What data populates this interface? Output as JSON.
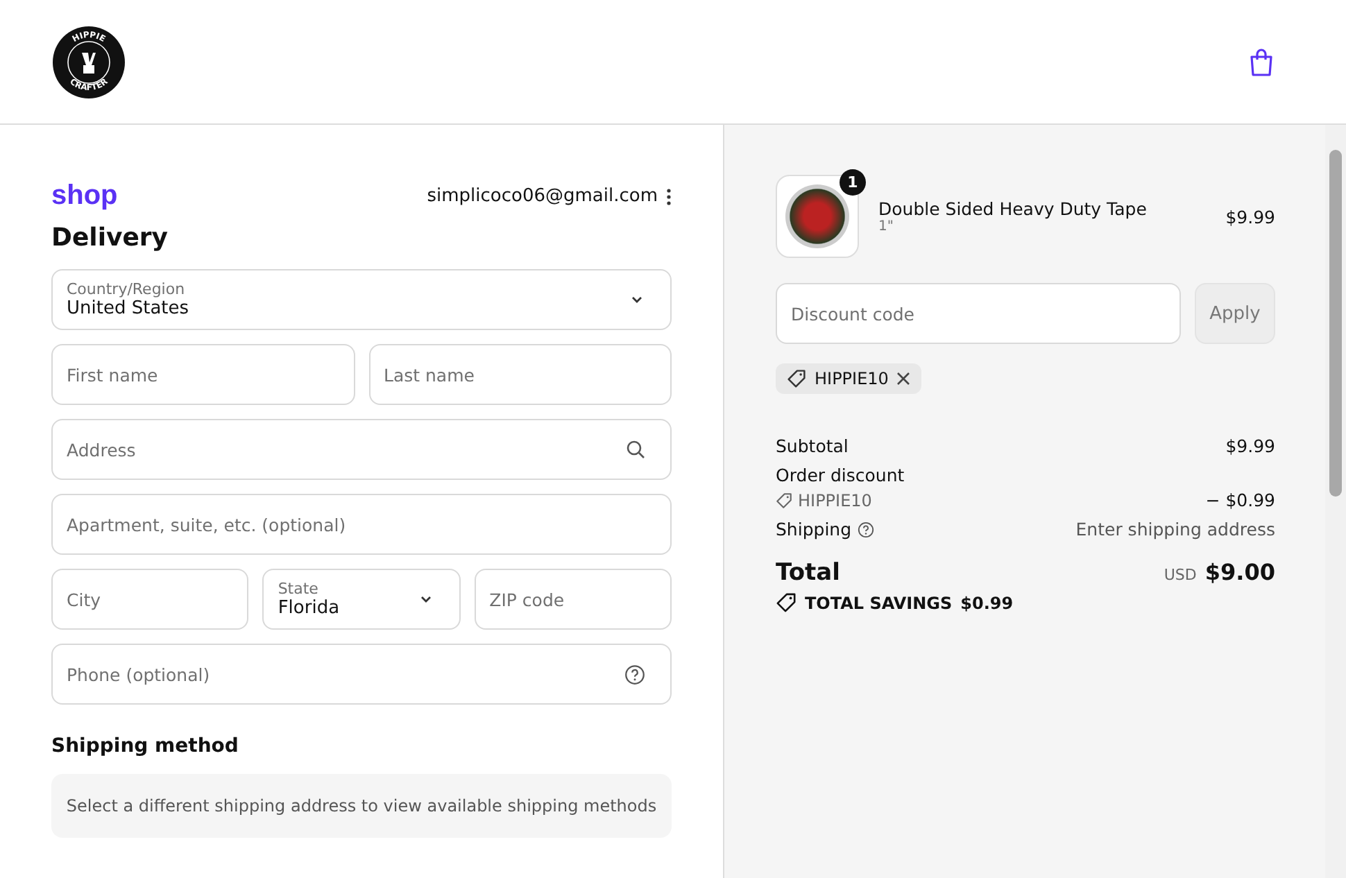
{
  "header": {
    "logo_top": "HIPPIE",
    "logo_bottom": "CRAFTER"
  },
  "account": {
    "brand": "shop",
    "email": "simplicoco06@gmail.com"
  },
  "delivery": {
    "title": "Delivery",
    "rows": [
      [
        {
          "kind": "select",
          "label": "Country/Region",
          "value": "United States"
        }
      ],
      [
        {
          "kind": "input",
          "placeholder": "First name"
        },
        {
          "kind": "input",
          "placeholder": "Last name"
        }
      ],
      [
        {
          "kind": "search_input",
          "placeholder": "Address"
        }
      ],
      [
        {
          "kind": "input",
          "placeholder": "Apartment, suite, etc. (optional)"
        }
      ],
      [
        {
          "kind": "input",
          "placeholder": "City"
        },
        {
          "kind": "select",
          "label": "State",
          "value": "Florida"
        },
        {
          "kind": "input",
          "placeholder": "ZIP code"
        }
      ],
      [
        {
          "kind": "help_input",
          "placeholder": "Phone (optional)"
        }
      ]
    ]
  },
  "shipping_method": {
    "title": "Shipping method",
    "message": "Select a different shipping address to view available shipping methods"
  },
  "summary": {
    "item": {
      "name": "Double Sided Heavy Duty Tape",
      "variant": "1\"",
      "quantity": "1",
      "price": "$9.99"
    },
    "discount": {
      "placeholder": "Discount code",
      "button": "Apply",
      "applied_code": "HIPPIE10"
    },
    "lines": [
      {
        "kind": "amount",
        "label": "Subtotal",
        "value": "$9.99"
      },
      {
        "kind": "discount",
        "label": "Order discount",
        "code": "HIPPIE10",
        "value": "− $0.99"
      },
      {
        "kind": "pending",
        "label": "Shipping",
        "value": "Enter shipping address"
      }
    ],
    "total": {
      "label": "Total",
      "currency": "USD",
      "value": "$9.00"
    },
    "savings": {
      "label": "TOTAL SAVINGS",
      "value": "$0.99"
    }
  }
}
